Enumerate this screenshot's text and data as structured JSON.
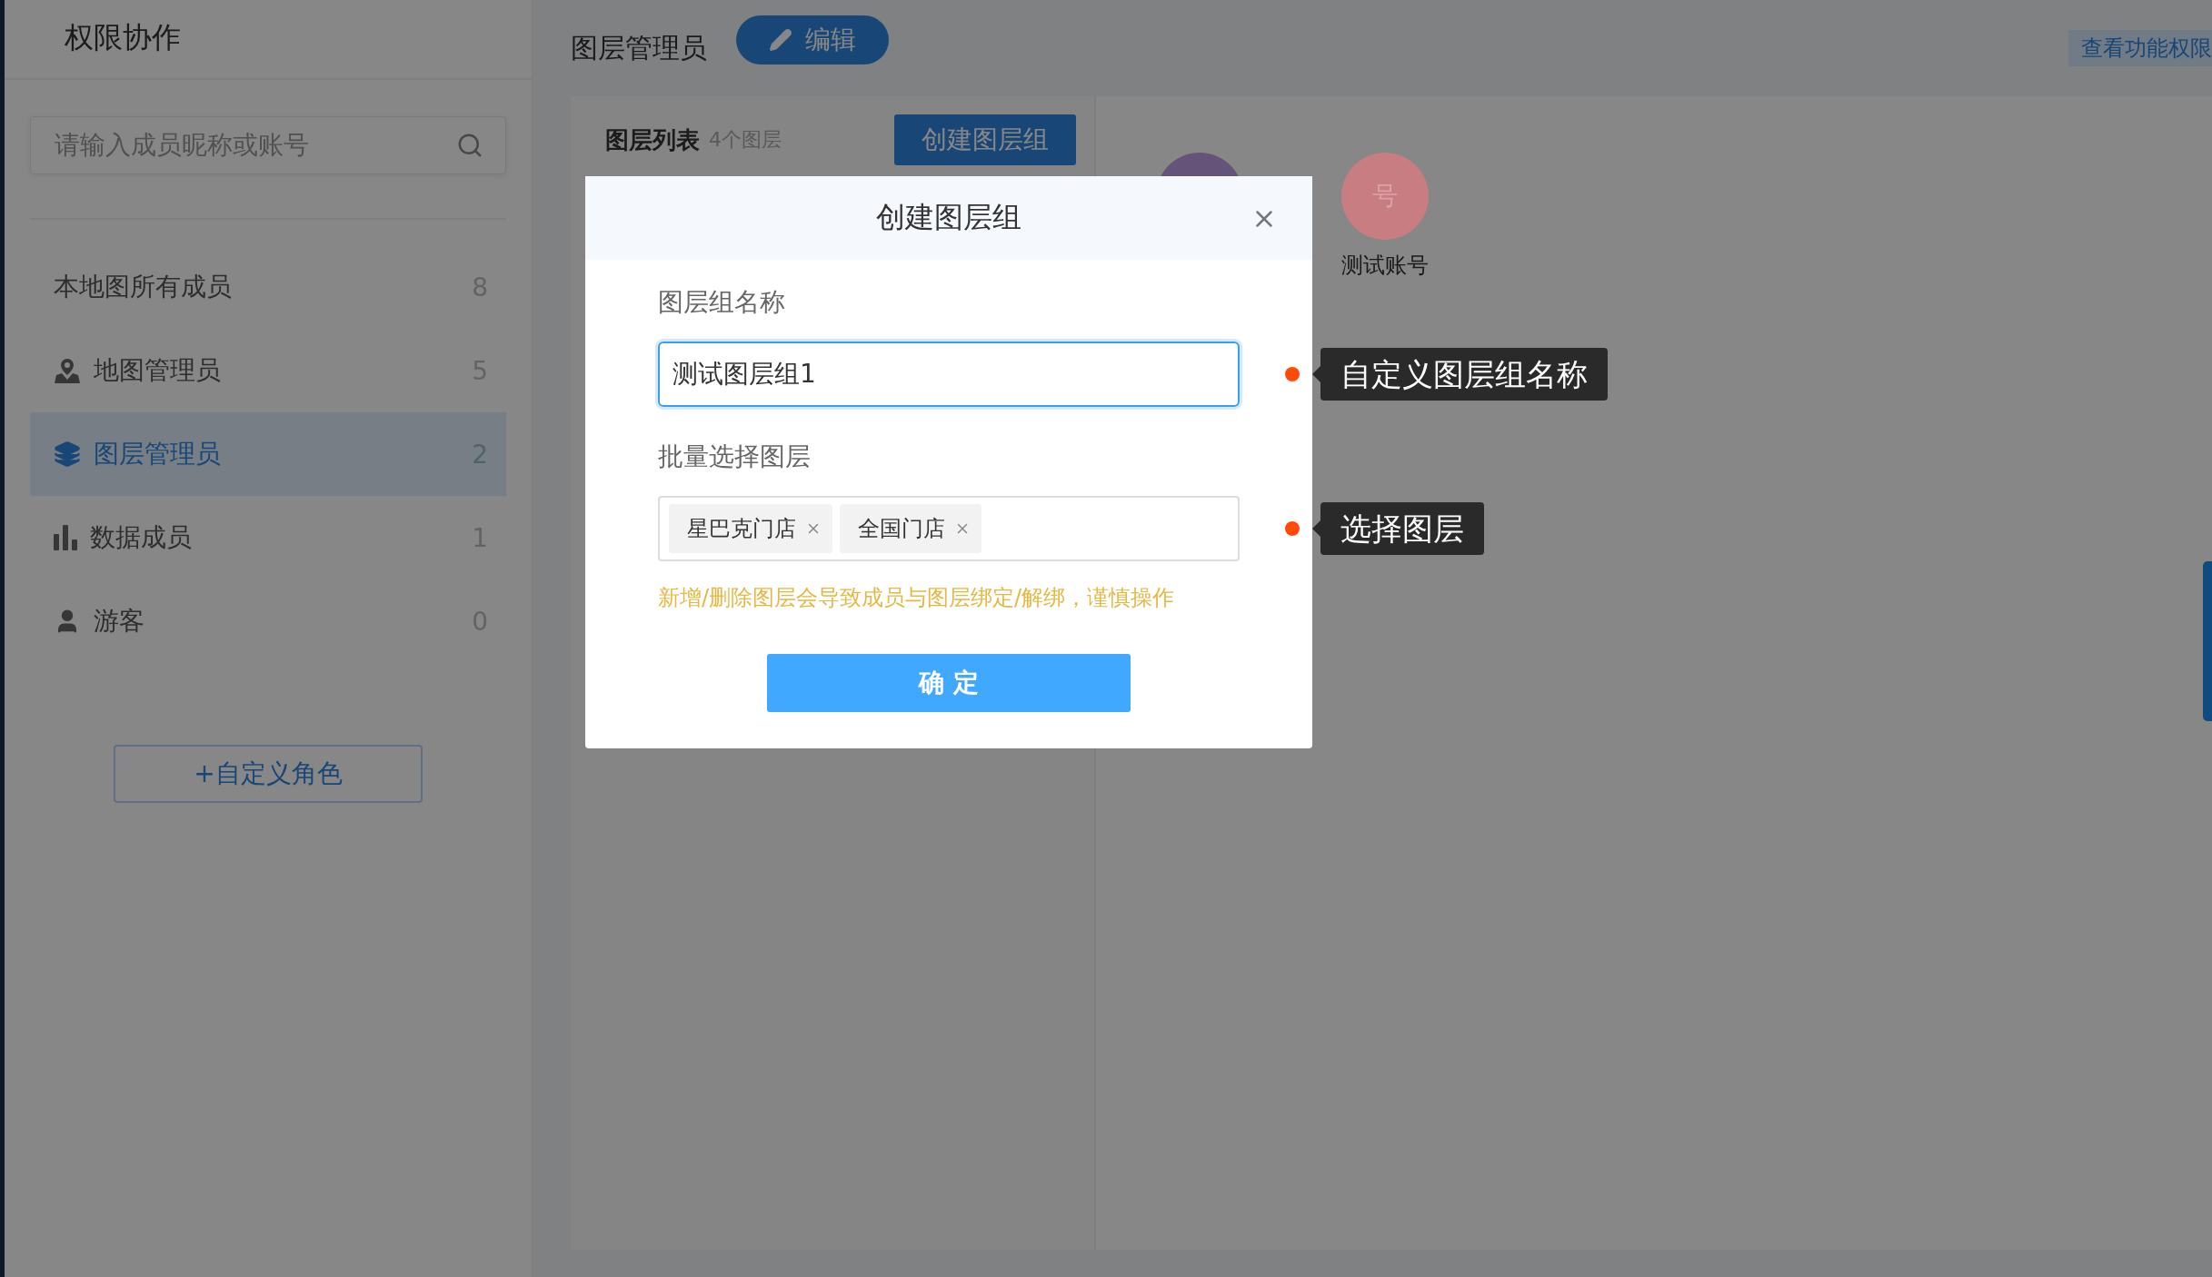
{
  "sidebar": {
    "title": "权限协作",
    "search": {
      "placeholder": "请输入成员昵称或账号"
    },
    "roles": [
      {
        "kind": "all",
        "label": "本地图所有成员",
        "count": "8",
        "selected": false
      },
      {
        "kind": "map",
        "label": "地图管理员",
        "count": "5",
        "selected": false
      },
      {
        "kind": "layer",
        "label": "图层管理员",
        "count": "2",
        "selected": true
      },
      {
        "kind": "data",
        "label": "数据成员",
        "count": "1",
        "selected": false
      },
      {
        "kind": "guest",
        "label": "游客",
        "count": "0",
        "selected": false
      }
    ],
    "add_role_button": "+自定义角色"
  },
  "header": {
    "title": "图层管理员",
    "edit_button": "编辑",
    "permissions_link": "查看功能权限"
  },
  "layer_panel": {
    "title": "图层列表",
    "count": "4个图层",
    "create_button": "创建图层组"
  },
  "members": [
    {
      "color": "#66537a"
    },
    {
      "avatar_text": "号",
      "name": "测试账号",
      "color": "#c87d82"
    }
  ],
  "dialog": {
    "title": "创建图层组",
    "fields": [
      {
        "kind": "text",
        "label": "图层组名称",
        "value": "测试图层组1",
        "focused": true,
        "annotation": "自定义图层组名称"
      },
      {
        "kind": "tags",
        "label": "批量选择图层",
        "tags": [
          "星巴克门店",
          "全国门店"
        ],
        "annotation": "选择图层"
      }
    ],
    "warning": "新增/删除图层会导致成员与图层绑定/解绑，谨慎操作",
    "confirm_button": "确 定"
  }
}
